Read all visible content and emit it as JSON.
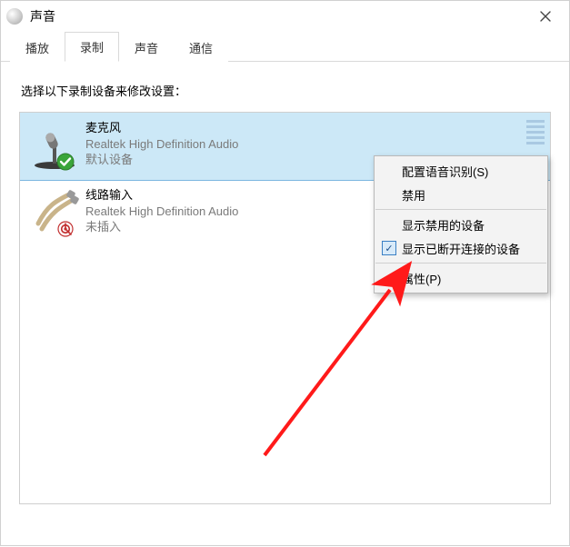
{
  "window": {
    "title": "声音"
  },
  "tabs": {
    "playback": "播放",
    "recording": "录制",
    "sounds": "声音",
    "communications": "通信"
  },
  "instruction": "选择以下录制设备来修改设置：",
  "devices": {
    "mic": {
      "name": "麦克风",
      "driver": "Realtek High Definition Audio",
      "status": "默认设备"
    },
    "line": {
      "name": "线路输入",
      "driver": "Realtek High Definition Audio",
      "status": "未插入"
    }
  },
  "context_menu": {
    "configure_speech": "配置语音识别(S)",
    "disable": "禁用",
    "show_disabled": "显示禁用的设备",
    "show_disconnected": "显示已断开连接的设备",
    "properties": "属性(P)"
  }
}
